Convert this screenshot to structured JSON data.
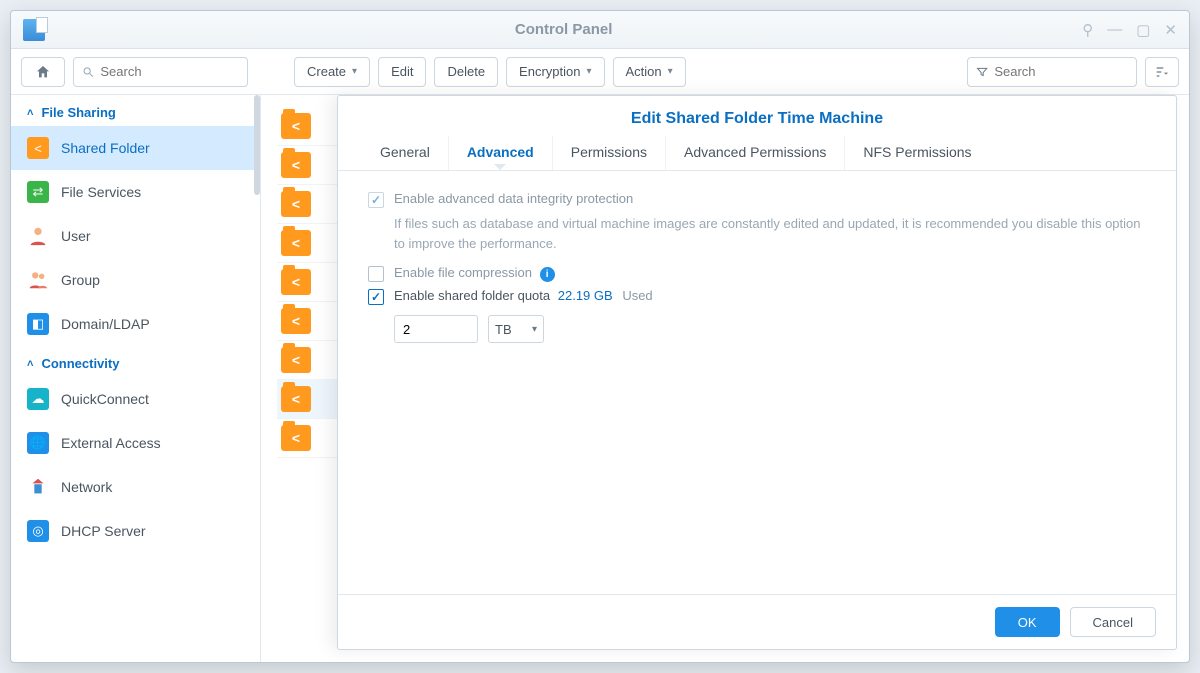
{
  "window": {
    "title": "Control Panel"
  },
  "toolbar": {
    "search_placeholder": "Search",
    "create": "Create",
    "edit": "Edit",
    "delete": "Delete",
    "encryption": "Encryption",
    "action": "Action",
    "filter_placeholder": "Search"
  },
  "sidebar": {
    "sections": [
      {
        "title": "File Sharing",
        "items": [
          {
            "label": "Shared Folder",
            "icon": "share",
            "color": "orange",
            "active": true
          },
          {
            "label": "File Services",
            "icon": "arrows",
            "color": "green"
          },
          {
            "label": "User",
            "icon": "person"
          },
          {
            "label": "Group",
            "icon": "people"
          },
          {
            "label": "Domain/LDAP",
            "icon": "domain",
            "color": "blue"
          }
        ]
      },
      {
        "title": "Connectivity",
        "items": [
          {
            "label": "QuickConnect",
            "icon": "cloud",
            "color": "teal"
          },
          {
            "label": "External Access",
            "icon": "globe",
            "color": "blue"
          },
          {
            "label": "Network",
            "icon": "network",
            "color": "red"
          },
          {
            "label": "DHCP Server",
            "icon": "dhcp",
            "color": "blue"
          }
        ]
      }
    ]
  },
  "modal": {
    "title": "Edit Shared Folder Time Machine",
    "tabs": [
      "General",
      "Advanced",
      "Permissions",
      "Advanced Permissions",
      "NFS Permissions"
    ],
    "active_tab": "Advanced",
    "opt1_label": "Enable advanced data integrity protection",
    "opt1_help": "If files such as database and virtual machine images are constantly edited and updated, it is recommended you disable this option to improve the performance.",
    "opt2_label": "Enable file compression",
    "opt3_label": "Enable shared folder quota",
    "quota_used": "22.19 GB",
    "quota_used_label": "Used",
    "quota_value": "2",
    "quota_unit": "TB",
    "ok": "OK",
    "cancel": "Cancel"
  }
}
